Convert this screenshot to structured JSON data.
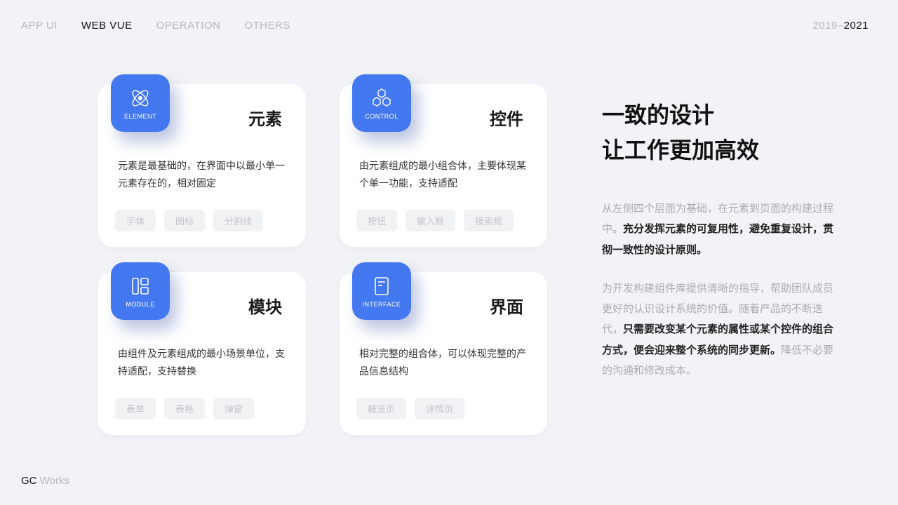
{
  "nav": {
    "items": [
      "APP UI",
      "WEB VUE",
      "OPERATION",
      "OTHERS"
    ],
    "active_index": 1
  },
  "year": {
    "range": "2019–",
    "current": "2021"
  },
  "brand": {
    "a": "GC ",
    "b": "Works"
  },
  "cards": [
    {
      "badge_label": "ELEMENT",
      "title": "元素",
      "desc": "元素是最基础的，在界面中以最小单一元素存在的，相对固定",
      "tags": [
        "字体",
        "图标",
        "分割线"
      ]
    },
    {
      "badge_label": "CONTROL",
      "title": "控件",
      "desc": "由元素组成的最小组合体，主要体现某个单一功能，支持适配",
      "tags": [
        "按钮",
        "输入框",
        "搜索框"
      ]
    },
    {
      "badge_label": "MODULE",
      "title": "模块",
      "desc": "由组件及元素组成的最小场景单位，支持适配，支持替换",
      "tags": [
        "表单",
        "表格",
        "弹窗"
      ]
    },
    {
      "badge_label": "INTERFACE",
      "title": "界面",
      "desc": "相对完整的组合体，可以体现完整的产品信息结构",
      "tags": [
        "概览页",
        "详情页"
      ]
    }
  ],
  "intro": {
    "h1_line1": "一致的设计",
    "h1_line2": "让工作更加高效",
    "p1_a": "从左侧四个层面为基础，在元素到页面的构建过程中。",
    "p1_b": "充分发挥元素的可复用性，避免重复设计，贯彻一致性的设计原则。",
    "p2_a": "为开发构建组件库提供清晰的指导，帮助团队成员更好的认识设计系统的价值。随着产品的不断迭代，",
    "p2_b": "只需要改变某个元素的属性或某个控件的组合方式，便会迎来整个系统的同步更新。",
    "p2_c": "降低不必要的沟通和修改成本。"
  }
}
